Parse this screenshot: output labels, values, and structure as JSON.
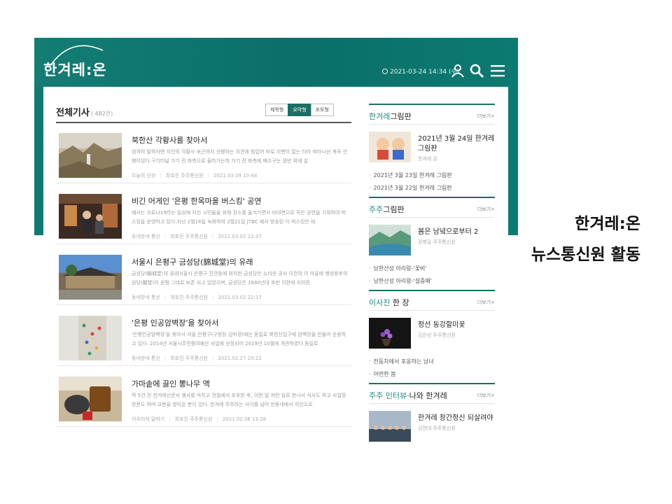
{
  "header": {
    "logo_text": "한겨레:온",
    "datetime": "2021-03-24 14:34 (수)"
  },
  "main": {
    "section_title": "전체기사",
    "count": "( 482건)",
    "view_options": [
      "제목형",
      "요약형",
      "포토형"
    ],
    "articles": [
      {
        "title": "북한산 각황사를 찾아서",
        "summary": "엄격히 말하자면 지인의 각황사 보근까지 산행하는 의견에 힘입어 따로 지변이 없는 타라 따라나선 계곡 산행이었다.구기터널 가기 전 좌측으로 올라가는데 가기 전 좌측에 배수구는 암반 위에 설",
        "category": "오늘의 단상",
        "author": "최호진 주주통신원",
        "date": "2021.03.09 10:44"
      },
      {
        "title": "비긴 어게인 '은평 한옥마을 버스킹' 공연",
        "summary": "예서는 코로나19라는 일상에 지친 시민들을 위해 장소를 옮겨가면서 비대면으로 작은 공연을 기획하여 버스킹을 운영하고 있다.지난 2월16일 녹화하여 2월21일 JTBC 에서 방송된 이 버스킹은 비",
        "category": "동네방네 통신",
        "author": "최호진 주주통신원",
        "date": "2021.03.02 22:37"
      },
      {
        "title": "서울시 은평구 금성당(錦城堂)의 유래",
        "summary": "금성당(錦城堂)의 유래서울시 은평구 진관동에 위치한 금성당은 뉴타운 공사 이전의 이 마을에 행성왕후의 원당(願堂)이 원형 그대로 보존 되고 있었으며, 금성당은 1880년대 조반 이전에 지어진",
        "category": "동네방네 통신",
        "author": "최호진 주주통신원",
        "date": "2021.03.02 22:17"
      },
      {
        "title": "'은평 인공암벽장'을 찾아서",
        "summary": "'은평인공암벽장'을 찾아서 서울 은평구(구청장 김미경)에는 동일로 북한산입구에 암벽장을 만들어 운용하고 있다. 2014년 서울시주민참여예산 사업에 선정되어 2019년 10월에 개관하였다.동일로",
        "category": "동네방네 통신",
        "author": "최호진 주주통신원",
        "date": "2021.02.27 20:22"
      },
      {
        "title": "가마솥에 끓인 뽕나무 액",
        "summary": "딱 5년 전 한겨레신문사 행사를 마치고 전철에서 조우한 후, 이런 일 저런 일로 만나서 식사도 하고 사업장 방문도 하며 교분을 쌓아온 분이 있다. 한겨레 주주라는 사이를 넘어 한동네에서 지인으로",
        "category": "어우러져 말하기",
        "author": "최호진 주주통신원",
        "date": "2021.02.06 13:28"
      }
    ]
  },
  "sidebar": {
    "more_label": "더보기+",
    "sections": [
      {
        "title_accent": "한겨레",
        "title_rest": "그림판",
        "feature_title": "2021년 3월 24일 한겨레 그림판",
        "feature_by": "한겨레 온",
        "items": [
          "2021년 3월 23일 한겨레 그림판",
          "2021년 3월 22일 한겨레 그림판"
        ]
      },
      {
        "title_accent": "주주",
        "title_rest": "그림판",
        "feature_title": "봄은 남녘으로부터 2",
        "feature_by": "정병길 주주통신원",
        "items": [
          "남한산성 아리랑-'꽃비'",
          "남한산성 아리랑-'설중매'"
        ]
      },
      {
        "title_accent": "이사진",
        "title_rest": " 한 장",
        "feature_title": "정선 동강할미꽃",
        "feature_by": "김은성 주주통신원",
        "items": [
          "전동차에서 포옹하는 남녀",
          "아련한 봄"
        ]
      },
      {
        "title_accent": "주주 인터뷰",
        "title_rest": "·나와 한겨레",
        "feature_title": "한겨레 창간정신 되살려야",
        "feature_by": "김연대 주주통신원",
        "items": []
      }
    ]
  },
  "caption": {
    "line1": "한겨레:온",
    "line2": "뉴스통신원 활동"
  },
  "colors": {
    "brand_teal": "#0c7a72",
    "accent_teal": "#1b8a80"
  }
}
